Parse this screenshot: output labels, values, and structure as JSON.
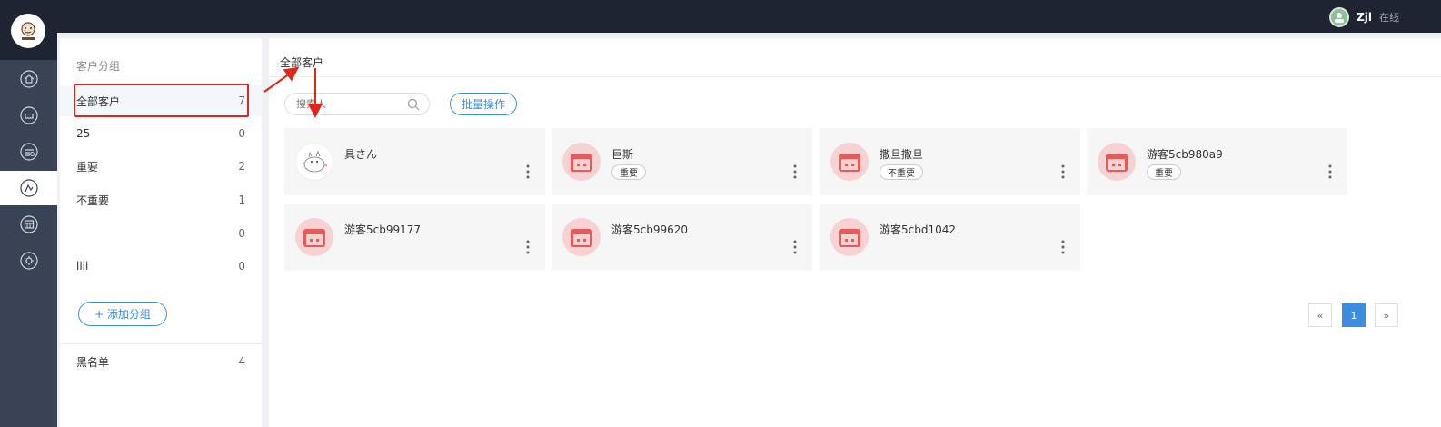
{
  "header": {
    "user_name": "Zjl",
    "user_status": "在线"
  },
  "nav": {
    "items": [
      {
        "icon": "home-icon"
      },
      {
        "icon": "chat-icon"
      },
      {
        "icon": "calendar-icon"
      },
      {
        "icon": "customers-icon"
      },
      {
        "icon": "form-icon"
      },
      {
        "icon": "settings-icon"
      }
    ],
    "active_index": 3
  },
  "groups": {
    "title": "客户分组",
    "items": [
      {
        "label": "全部客户",
        "count": "7"
      },
      {
        "label": "25",
        "count": "0"
      },
      {
        "label": "重要",
        "count": "2"
      },
      {
        "label": "不重要",
        "count": "1"
      },
      {
        "label": "",
        "count": "0"
      },
      {
        "label": "lili",
        "count": "0"
      }
    ],
    "add_label": "+ 添加分组",
    "blacklist": {
      "label": "黑名单",
      "count": "4"
    }
  },
  "main": {
    "breadcrumb": "全部客户",
    "search_placeholder": "搜索人",
    "batch_label": "批量操作"
  },
  "customers": [
    {
      "name": "具さん",
      "tag": ""
    },
    {
      "name": "巨斯",
      "tag": "重要"
    },
    {
      "name": "撒旦撒旦",
      "tag": "不重要"
    },
    {
      "name": "游客5cb980a9",
      "tag": "重要"
    },
    {
      "name": "游客5cb99177",
      "tag": ""
    },
    {
      "name": "游客5cb99620",
      "tag": ""
    },
    {
      "name": "游客5cbd1042",
      "tag": ""
    }
  ],
  "pagination": {
    "prev": "«",
    "current": "1",
    "next": "»"
  },
  "colors": {
    "accent": "#3c8de0",
    "highlight": "#e0251d",
    "nav_bg": "#3a4256",
    "topbar_bg": "#1f2433"
  }
}
